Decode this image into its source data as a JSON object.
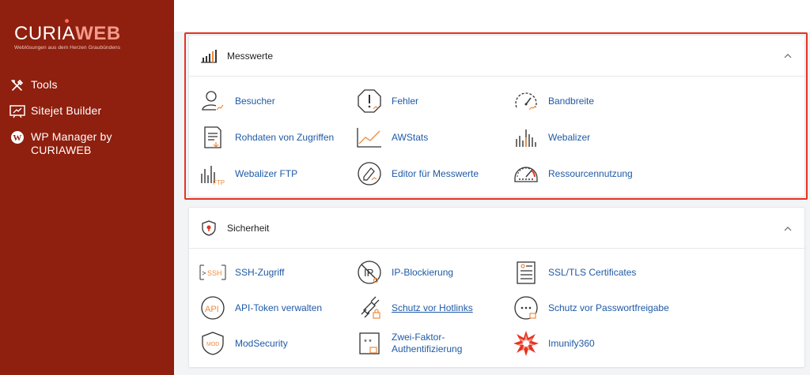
{
  "brand": {
    "logo_main_a": "CURIA",
    "logo_main_b": "WEB",
    "tagline": "Weblösungen aus dem Herzen Graubündens"
  },
  "sidebar": {
    "items": [
      {
        "label": "Tools",
        "icon": "tools-icon"
      },
      {
        "label": "Sitejet Builder",
        "icon": "sitejet-icon"
      },
      {
        "label": "WP Manager by\nCURIAWEB",
        "icon": "wordpress-icon"
      }
    ]
  },
  "colors": {
    "sidebar_bg": "#8f1f0e",
    "link": "#1f5aa6",
    "accent": "#f08a3c",
    "highlight": "#e8321f"
  },
  "sections": [
    {
      "title": "Messwerte",
      "items": [
        {
          "label": "Besucher",
          "icon": "visitors-icon"
        },
        {
          "label": "Fehler",
          "icon": "errors-icon"
        },
        {
          "label": "Bandbreite",
          "icon": "bandwidth-icon"
        },
        {
          "label": "Rohdaten von Zugriffen",
          "icon": "raw-access-icon"
        },
        {
          "label": "AWStats",
          "icon": "awstats-icon"
        },
        {
          "label": "Webalizer",
          "icon": "webalizer-icon"
        },
        {
          "label": "Webalizer FTP",
          "icon": "webalizer-ftp-icon"
        },
        {
          "label": "Editor für Messwerte",
          "icon": "metrics-editor-icon"
        },
        {
          "label": "Ressourcennutzung",
          "icon": "resource-usage-icon"
        }
      ]
    },
    {
      "title": "Sicherheit",
      "items": [
        {
          "label": "SSH-Zugriff",
          "icon": "ssh-icon"
        },
        {
          "label": "IP-Blockierung",
          "icon": "ip-blocker-icon"
        },
        {
          "label": "SSL/TLS Certificates",
          "icon": "ssl-icon"
        },
        {
          "label": "API-Token verwalten",
          "icon": "api-token-icon"
        },
        {
          "label": "Schutz vor Hotlinks",
          "icon": "hotlink-icon"
        },
        {
          "label": "Schutz vor Passwortfreigabe",
          "icon": "leech-protect-icon"
        },
        {
          "label": "ModSecurity",
          "icon": "modsecurity-icon"
        },
        {
          "label": "Zwei-Faktor-\nAuthentifizierung",
          "icon": "two-factor-icon"
        },
        {
          "label": "Imunify360",
          "icon": "imunify-icon"
        }
      ]
    }
  ]
}
